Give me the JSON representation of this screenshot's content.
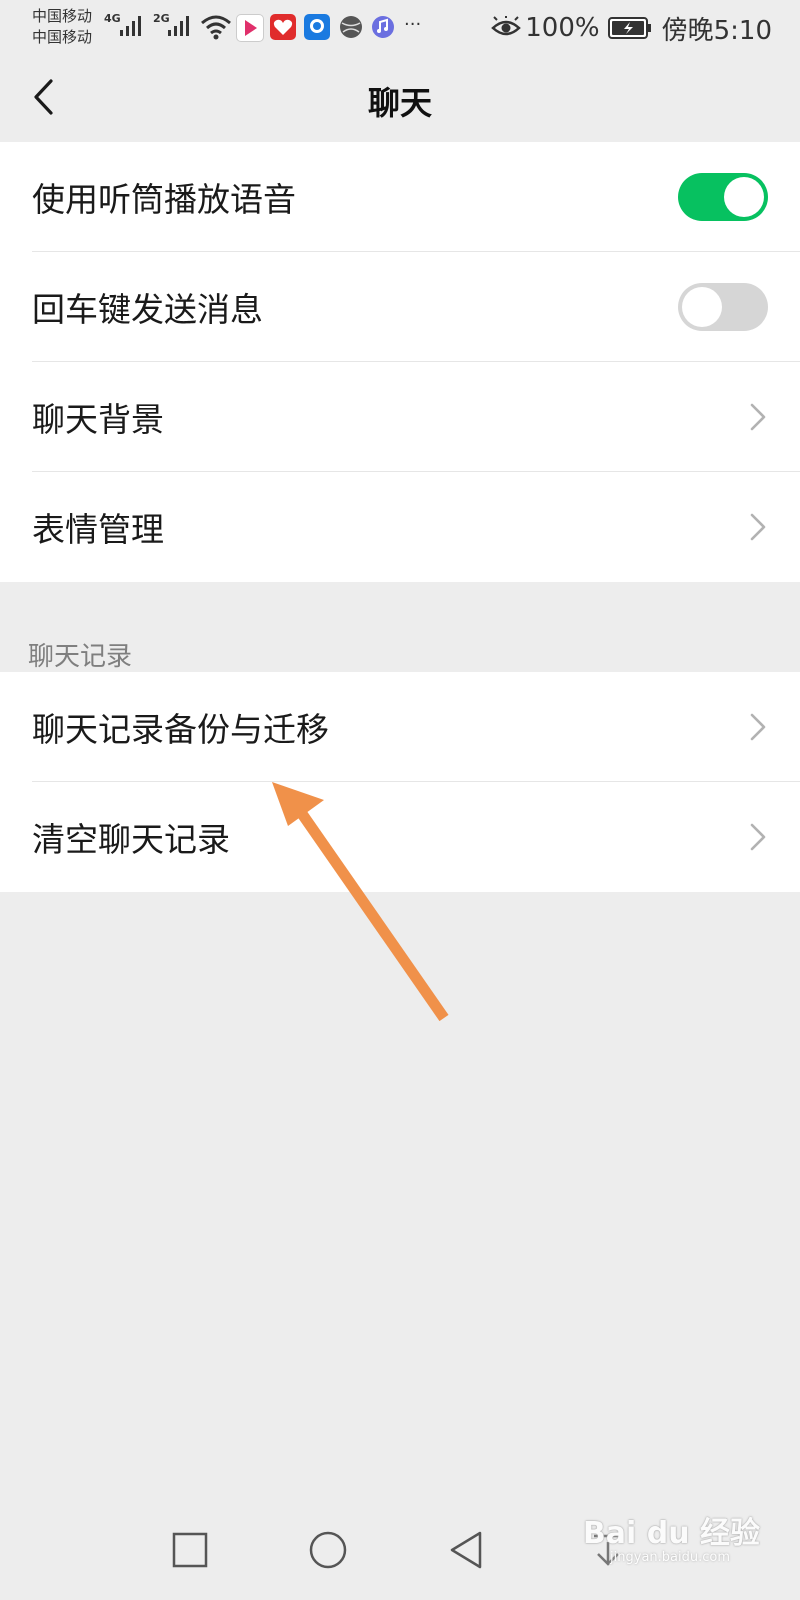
{
  "status_bar": {
    "carrier_1": "中国移动",
    "carrier_2": "中国移动",
    "net_1": "4G",
    "net_2": "2G",
    "more": "···",
    "battery": "100%",
    "time": "傍晚5:10"
  },
  "nav": {
    "title": "聊天"
  },
  "settings": {
    "group1": [
      {
        "label": "使用听筒播放语音",
        "control": "toggle",
        "state": "on"
      },
      {
        "label": "回车键发送消息",
        "control": "toggle",
        "state": "off"
      },
      {
        "label": "聊天背景",
        "control": "chevron"
      },
      {
        "label": "表情管理",
        "control": "chevron"
      }
    ],
    "section_header": "聊天记录",
    "group2": [
      {
        "label": "聊天记录备份与迁移",
        "control": "chevron"
      },
      {
        "label": "清空聊天记录",
        "control": "chevron"
      }
    ]
  },
  "watermark": {
    "main": "Bai du 经验",
    "sub": "jingyan.baidu.com"
  },
  "colors": {
    "toggle_on": "#07c160",
    "toggle_off": "#d6d6d6",
    "background": "#ededed",
    "arrow": "#f0914a"
  }
}
